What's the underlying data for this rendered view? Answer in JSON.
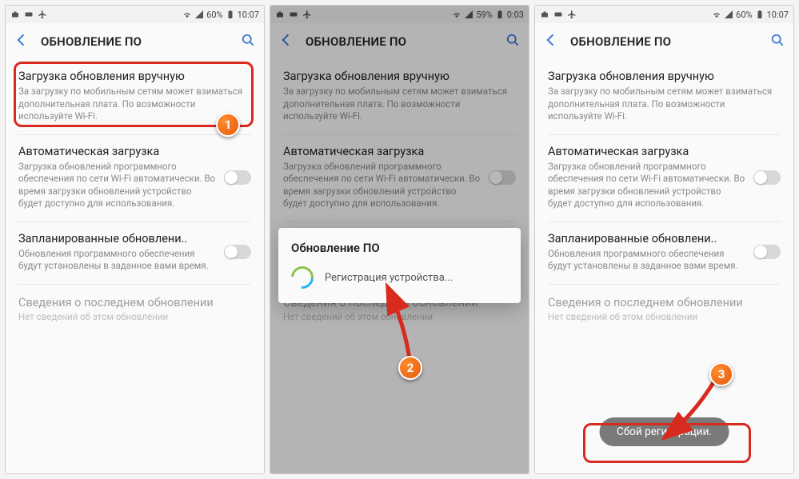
{
  "status": {
    "signal_pct1": "60%",
    "signal_pct2": "59%",
    "time1": "10:07",
    "time2": "0:03",
    "time3": "10:07"
  },
  "header": {
    "title": "ОБНОВЛЕНИЕ ПО"
  },
  "items": {
    "manual": {
      "title": "Загрузка обновления вручную",
      "sub": "За загрузку по мобильным сетям может взиматься дополнительная плата. По возможности используйте Wi-Fi."
    },
    "auto": {
      "title": "Автоматическая загрузка",
      "sub": "Загрузка обновлений программного обеспечения по сети Wi-Fi автоматически. Во время загрузки обновлений устройство будет доступно для использования."
    },
    "scheduled": {
      "title": "Запланированные обновлени..",
      "sub": "Обновления программного обеспечения будут установлены в заданное вами время."
    },
    "last": {
      "title": "Сведения о последнем обновлении",
      "sub": "Нет сведений об этом обновлении"
    }
  },
  "modal": {
    "title": "Обновление ПО",
    "text": "Регистрация устройства..."
  },
  "toast": "Сбой регистрации.",
  "callouts": {
    "one": "1",
    "two": "2",
    "three": "3"
  }
}
